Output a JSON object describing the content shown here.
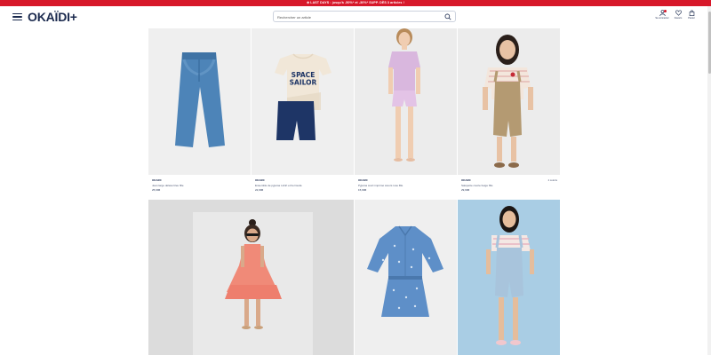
{
  "promo_bar": {
    "text": "⊕ LAST DAYS : jusqu'à -50%* et -30%* SUPP. DÈS 3 articles !"
  },
  "header": {
    "logo": "OKAÏDI+",
    "search_placeholder": "Rechercher un article",
    "icons": [
      {
        "name": "account-icon",
        "label": "Se connecter"
      },
      {
        "name": "heart-icon",
        "label": "Favoris"
      },
      {
        "name": "bag-icon",
        "label": "Panier"
      }
    ]
  },
  "products": [
    {
      "brand": "OKAIDI",
      "name": "Jean large délavé bleu fille",
      "price": "25,99€",
      "colors": ""
    },
    {
      "brand": "OKAIDI",
      "name": "Ensemble de pyjama t-shirt et bermuda",
      "price": "22,99€",
      "colors": ""
    },
    {
      "brand": "OKAIDI",
      "name": "Pyjama court imprimé cœurs rose fille",
      "price": "15,99€",
      "colors": ""
    },
    {
      "brand": "OKAIDI",
      "name": "Salopette courte beige fille",
      "price": "29,99€",
      "colors": "2 coloris"
    },
    {
      "brand": "",
      "name": "",
      "price": "",
      "colors": ""
    },
    {
      "brand": "",
      "name": "",
      "price": "",
      "colors": ""
    },
    {
      "brand": "",
      "name": "",
      "price": "",
      "colors": ""
    }
  ],
  "tshirt_print": {
    "line1": "SPACE",
    "line2": "SAILOR"
  },
  "colors": {
    "promo_red": "#d7182a",
    "navy": "#1b2a4e",
    "photo_bg": "#efefef",
    "sky_bg": "#a9cde4"
  }
}
